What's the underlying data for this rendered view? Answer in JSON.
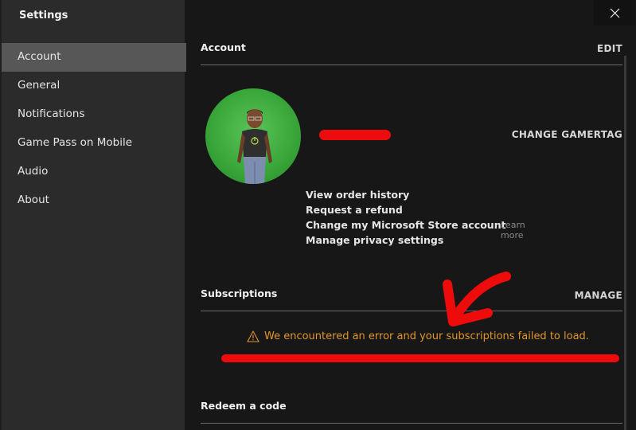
{
  "sidebar": {
    "title": "Settings",
    "items": [
      {
        "label": "Account",
        "active": true
      },
      {
        "label": "General"
      },
      {
        "label": "Notifications"
      },
      {
        "label": "Game Pass on Mobile"
      },
      {
        "label": "Audio"
      },
      {
        "label": "About"
      }
    ]
  },
  "window": {
    "close_icon": "close-icon"
  },
  "account": {
    "title": "Account",
    "edit_label": "EDIT",
    "gamertag": "[redacted]",
    "change_gamertag_label": "CHANGE GAMERTAG",
    "links": [
      "View order history",
      "Request a refund",
      "Change my Microsoft Store account",
      "Manage privacy settings"
    ],
    "learn_more_label": "Learn more"
  },
  "subscriptions": {
    "title": "Subscriptions",
    "manage_label": "MANAGE",
    "error_icon": "warning-icon",
    "error_text": "We encountered an error and your subscriptions failed to load.",
    "error_color": "#e0952d"
  },
  "redeem": {
    "title": "Redeem a code"
  },
  "annotations": {
    "color": "#ee0b0b",
    "items": [
      "arrow pointing to error",
      "underline under error message",
      "redaction over gamertag"
    ]
  }
}
